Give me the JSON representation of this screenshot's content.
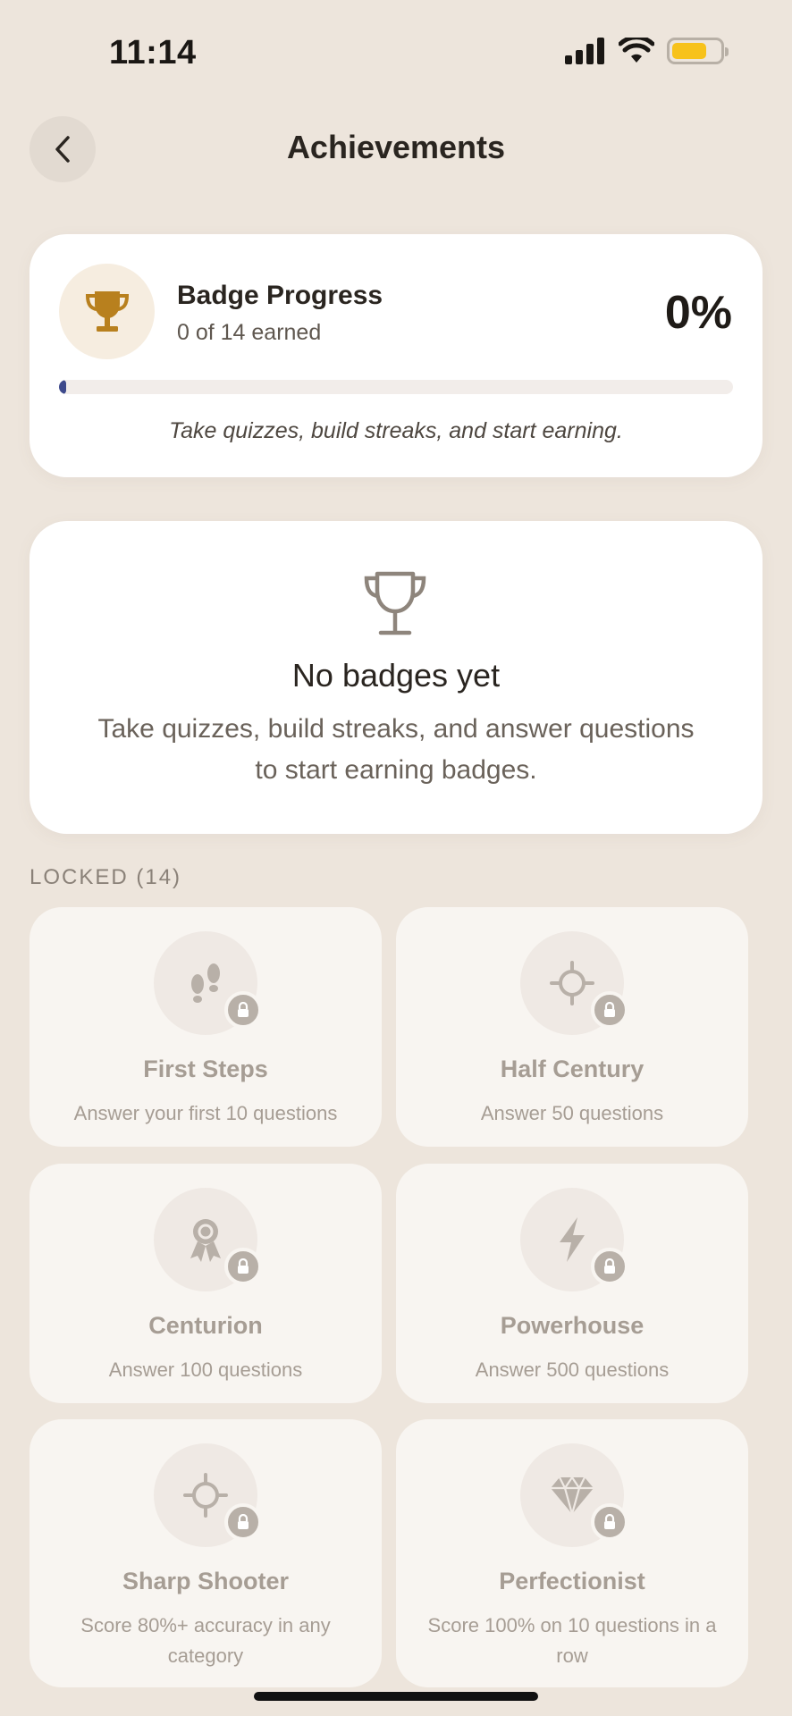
{
  "status_bar": {
    "time": "11:14"
  },
  "header": {
    "title": "Achievements"
  },
  "progress": {
    "title": "Badge Progress",
    "subtitle": "0 of 14 earned",
    "percent_text": "0%",
    "percent_value": 0,
    "hint": "Take quizzes, build streaks, and start earning."
  },
  "empty_state": {
    "title": "No badges yet",
    "description": "Take quizzes, build streaks, and answer questions to start earning badges."
  },
  "locked_section": {
    "label": "LOCKED (14)"
  },
  "badges": [
    {
      "name": "First Steps",
      "description": "Answer your first 10 questions",
      "icon": "footprints-icon"
    },
    {
      "name": "Half Century",
      "description": "Answer 50 questions",
      "icon": "crosshair-icon"
    },
    {
      "name": "Centurion",
      "description": "Answer 100 questions",
      "icon": "award-ribbon-icon"
    },
    {
      "name": "Powerhouse",
      "description": "Answer 500 questions",
      "icon": "lightning-bolt-icon"
    },
    {
      "name": "Sharp Shooter",
      "description": "Score 80%+ accuracy in any category",
      "icon": "crosshair-icon"
    },
    {
      "name": "Perfectionist",
      "description": "Score 100% on 10 questions in a row",
      "icon": "diamond-icon"
    }
  ],
  "colors": {
    "background": "#EDE5DC",
    "card": "#FFFFFF",
    "trophy_gold": "#B8801E",
    "progress_fill": "#3E4A8C",
    "locked_text": "#A69D94"
  }
}
